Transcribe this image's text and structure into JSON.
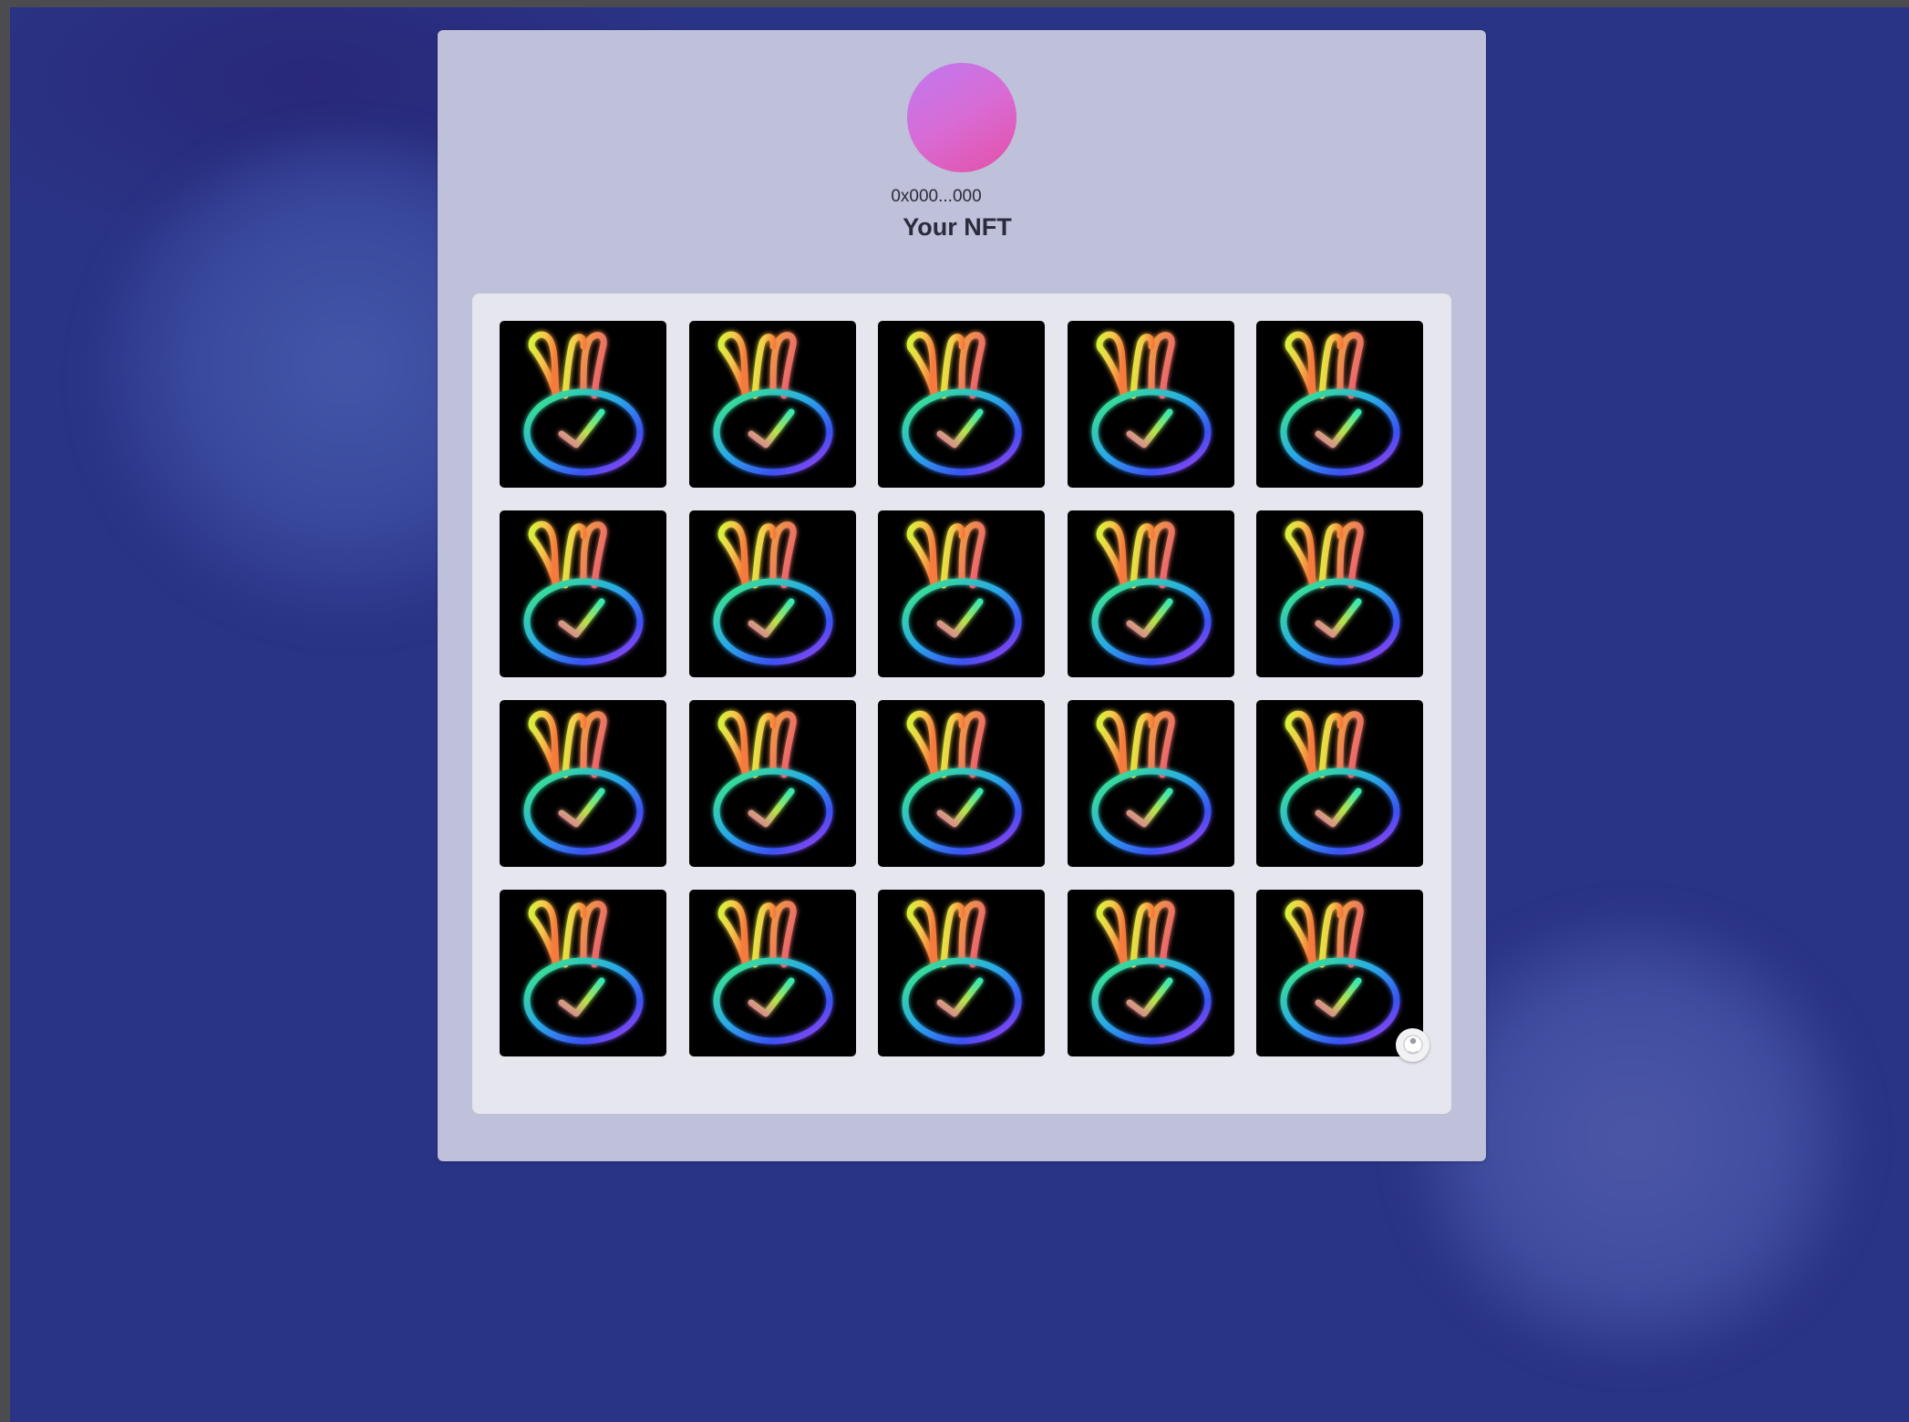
{
  "profile": {
    "address": "0x000...000",
    "title": "Your NFT",
    "avatar_gradient": [
      "#c079f0",
      "#e54fa6"
    ]
  },
  "nfts": [
    {
      "icon": "neon-bunny-check-icon"
    },
    {
      "icon": "neon-bunny-check-icon"
    },
    {
      "icon": "neon-bunny-check-icon"
    },
    {
      "icon": "neon-bunny-check-icon"
    },
    {
      "icon": "neon-bunny-check-icon"
    },
    {
      "icon": "neon-bunny-check-icon"
    },
    {
      "icon": "neon-bunny-check-icon"
    },
    {
      "icon": "neon-bunny-check-icon"
    },
    {
      "icon": "neon-bunny-check-icon"
    },
    {
      "icon": "neon-bunny-check-icon"
    },
    {
      "icon": "neon-bunny-check-icon"
    },
    {
      "icon": "neon-bunny-check-icon"
    },
    {
      "icon": "neon-bunny-check-icon"
    },
    {
      "icon": "neon-bunny-check-icon"
    },
    {
      "icon": "neon-bunny-check-icon"
    },
    {
      "icon": "neon-bunny-check-icon"
    },
    {
      "icon": "neon-bunny-check-icon"
    },
    {
      "icon": "neon-bunny-check-icon"
    },
    {
      "icon": "neon-bunny-check-icon"
    },
    {
      "icon": "neon-bunny-check-icon"
    }
  ],
  "colors": {
    "background": "#2a3486",
    "card": "#bfc0d9",
    "grid_panel": "#e6e6ef",
    "tile": "#000000"
  },
  "floating_button": {
    "icon": "chat-bubble-icon"
  }
}
